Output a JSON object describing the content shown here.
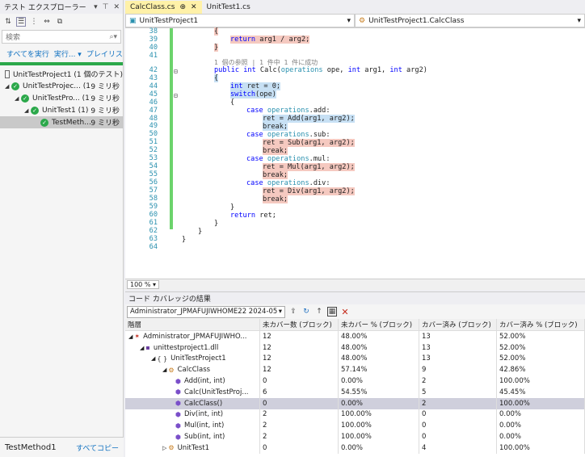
{
  "test_explorer": {
    "title": "テスト エクスプローラー",
    "title_buttons": [
      "▾",
      "⊤",
      "✕"
    ],
    "search_placeholder": "検索",
    "actions": [
      "すべてを実行",
      "実行...",
      "プレイリス"
    ],
    "summary": "UnitTestProject1 (1 個のテスト)",
    "tree": [
      {
        "label": "UnitTestProjec...",
        "count": "(1)",
        "time": "9 ミリ秒",
        "level": 0
      },
      {
        "label": "UnitTestPro...",
        "count": "(1)",
        "time": "9 ミリ秒",
        "level": 1
      },
      {
        "label": "UnitTest1",
        "count": "(1)",
        "time": "9 ミリ秒",
        "level": 2
      },
      {
        "label": "TestMeth...",
        "count": "",
        "time": "9 ミリ秒",
        "level": 3
      }
    ],
    "detail_name": "TestMethod1",
    "copy_all": "すべてコピー"
  },
  "tabs": [
    {
      "label": "CalcClass.cs",
      "pin": "⊕",
      "close": "✕"
    },
    {
      "label": "UnitTest1.cs"
    }
  ],
  "navbar": {
    "project": "UnitTestProject1",
    "class": "UnitTestProject1.CalcClass"
  },
  "code": {
    "line_numbers": [
      "38",
      "39",
      "40",
      "41",
      "42",
      "43",
      "44",
      "45",
      "46",
      "47",
      "48",
      "49",
      "50",
      "51",
      "52",
      "53",
      "54",
      "55",
      "56",
      "57",
      "58",
      "59",
      "60",
      "61",
      "62",
      "63",
      "64"
    ],
    "ref_lens": "1 個の参照 | 1 件中 1 件に成功"
  },
  "zoom": "100 %",
  "coverage": {
    "title": "コード カバレッジの結果",
    "combo": "Administrator_JPMAFUJIWHOME22 2024-05",
    "headers": [
      "階層",
      "未カバー数 (ブロック)",
      "未カバー % (ブロック)",
      "カバー済み (ブロック)",
      "カバー済み % (ブロック)"
    ],
    "rows": [
      {
        "name": "Administrator_JPMAFUJIWHO...",
        "c2": "12",
        "c3": "48.00%",
        "c4": "13",
        "c5": "52.00%",
        "indent": 0
      },
      {
        "name": "unittestproject1.dll",
        "c2": "12",
        "c3": "48.00%",
        "c4": "13",
        "c5": "52.00%",
        "indent": 1
      },
      {
        "name": "UnitTestProject1",
        "c2": "12",
        "c3": "48.00%",
        "c4": "13",
        "c5": "52.00%",
        "indent": 2
      },
      {
        "name": "CalcClass",
        "c2": "12",
        "c3": "57.14%",
        "c4": "9",
        "c5": "42.86%",
        "indent": 3
      },
      {
        "name": "Add(int, int)",
        "c2": "0",
        "c3": "0.00%",
        "c4": "2",
        "c5": "100.00%",
        "indent": 4
      },
      {
        "name": "Calc(UnitTestProj...",
        "c2": "6",
        "c3": "54.55%",
        "c4": "5",
        "c5": "45.45%",
        "indent": 4
      },
      {
        "name": "CalcClass()",
        "c2": "0",
        "c3": "0.00%",
        "c4": "2",
        "c5": "100.00%",
        "indent": 4
      },
      {
        "name": "Div(int, int)",
        "c2": "2",
        "c3": "100.00%",
        "c4": "0",
        "c5": "0.00%",
        "indent": 4
      },
      {
        "name": "Mul(int, int)",
        "c2": "2",
        "c3": "100.00%",
        "c4": "0",
        "c5": "0.00%",
        "indent": 4
      },
      {
        "name": "Sub(int, int)",
        "c2": "2",
        "c3": "100.00%",
        "c4": "0",
        "c5": "0.00%",
        "indent": 4
      },
      {
        "name": "UnitTest1",
        "c2": "0",
        "c3": "0.00%",
        "c4": "4",
        "c5": "100.00%",
        "indent": 3
      }
    ]
  }
}
